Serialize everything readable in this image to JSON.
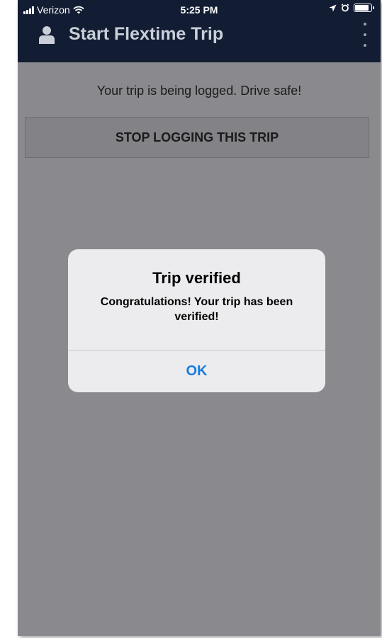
{
  "status_bar": {
    "carrier": "Verizon",
    "time": "5:25 PM"
  },
  "nav": {
    "title": "Start Flextime Trip",
    "icons": [
      "user-icon",
      "more-vertical-icon"
    ]
  },
  "main": {
    "message": "Your trip is being logged. Drive safe!",
    "stop_button_label": "STOP LOGGING THIS TRIP"
  },
  "alert": {
    "title": "Trip verified",
    "body": "Congratulations! Your trip has been verified!",
    "ok_label": "OK"
  },
  "colors": {
    "nav_background": "#121d33",
    "overlay_background": "#8a8a8e",
    "alert_button": "#1a7be0"
  }
}
